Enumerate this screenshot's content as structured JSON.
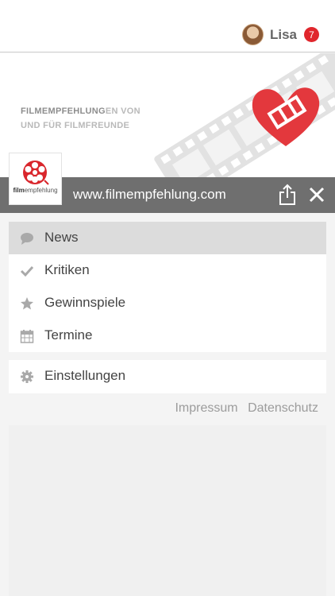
{
  "header": {
    "user_name": "Lisa",
    "notification_count": "7"
  },
  "hero": {
    "tagline_strong": "FILMEMPFEHLUNG",
    "tagline_rest": "EN VON",
    "tagline_line2": "UND FÜR FILMFREUNDE"
  },
  "logo": {
    "text_bold": "film",
    "text_rest": "empfehlung"
  },
  "urlbar": {
    "url": "www.filmempfehlung.com"
  },
  "menu": {
    "items": [
      {
        "label": "News",
        "icon": "speech-bubble-icon"
      },
      {
        "label": "Kritiken",
        "icon": "checkmark-icon"
      },
      {
        "label": "Gewinnspiele",
        "icon": "star-icon"
      },
      {
        "label": "Termine",
        "icon": "calendar-icon"
      }
    ],
    "settings": {
      "label": "Einstellungen",
      "icon": "gear-icon"
    }
  },
  "footer": {
    "impressum": "Impressum",
    "datenschutz": "Datenschutz"
  },
  "colors": {
    "accent": "#e0262c",
    "urlbar": "#6f6f6f",
    "active_item": "#dcdcdc"
  }
}
